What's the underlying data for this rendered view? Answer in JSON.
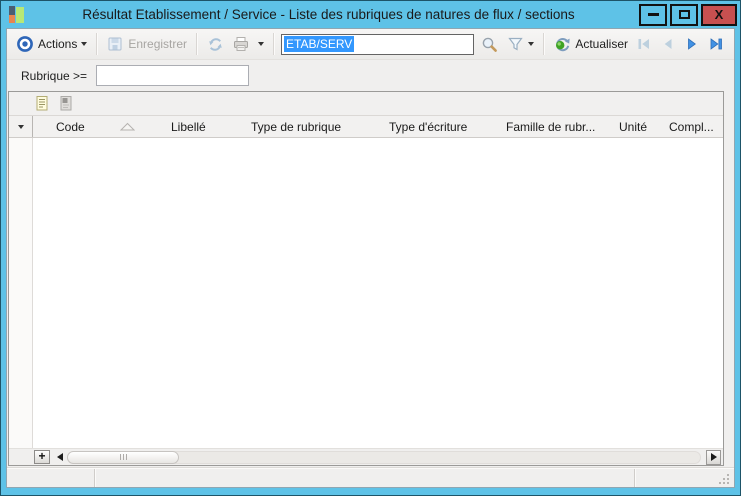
{
  "window": {
    "title": "Résultat Etablissement / Service -  Liste des rubriques de natures de flux / sections",
    "controls": {
      "minimize": "",
      "maximize": "",
      "close": "X"
    }
  },
  "toolbar": {
    "actions_label": "Actions",
    "save_label": "Enregistrer",
    "search_value": "ETAB/SERV",
    "refresh_label": "Actualiser"
  },
  "filter": {
    "label": "Rubrique >=",
    "value": "",
    "placeholder": ""
  },
  "grid": {
    "columns": [
      "Code",
      "Libellé",
      "Type de rubrique",
      "Type d'écriture",
      "Famille de rubr...",
      "Unité",
      "Compl..."
    ],
    "sorted_column": "Code",
    "sort_direction": "ascending",
    "rows": []
  },
  "scrollbar": {
    "add_label": "+"
  },
  "colors": {
    "titlebar": "#5EC2E7",
    "close_button": "#C75050",
    "selection": "#3297FD",
    "nav_active": "#4292E4",
    "nav_disabled": "#BDD0DE",
    "accent_blue": "#2E66B8",
    "refresh_green": "#3FA324"
  }
}
